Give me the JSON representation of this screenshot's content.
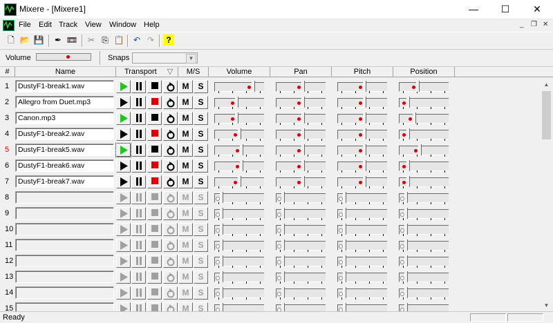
{
  "window": {
    "title": "Mixere - [Mixere1]",
    "minimize": "—",
    "maximize": "☐",
    "close": "✕"
  },
  "menubar": {
    "items": [
      "File",
      "Edit",
      "Track",
      "View",
      "Window",
      "Help"
    ],
    "mdi": {
      "minimize": "_",
      "restore": "❐",
      "close": "✕"
    }
  },
  "toolbar": {
    "icons": [
      "new-icon",
      "open-icon",
      "save-icon",
      "properties-icon",
      "tape-icon",
      "cut-icon",
      "copy-icon",
      "paste-icon",
      "undo-icon",
      "redo-icon",
      "help-icon"
    ],
    "glyphs": [
      "🗋",
      "📂",
      "💾",
      "✒",
      "📼",
      "✂",
      "⎘",
      "📋",
      "↶",
      "↷",
      "?"
    ]
  },
  "mixbar": {
    "volume_label": "Volume",
    "snaps_label": "Snaps",
    "snaps_value": "",
    "volume_level": 0.75
  },
  "header": {
    "num": "#",
    "name": "Name",
    "transport": "Transport",
    "transport_arrow": "▽",
    "ms": "M/S",
    "volume": "Volume",
    "pan": "Pan",
    "pitch": "Pitch",
    "position": "Position"
  },
  "labels": {
    "mute": "M",
    "solo": "S"
  },
  "rows": [
    {
      "num": "1",
      "name": "DustyF1-break1.wav",
      "active": true,
      "playing": true,
      "recording": false,
      "vol": 0.8,
      "pan": 0.5,
      "pitch": 0.5,
      "pos": 0.3
    },
    {
      "num": "2",
      "name": "Allegro from Duet.mp3",
      "active": true,
      "playing": false,
      "recording": true,
      "vol": 0.38,
      "pan": 0.5,
      "pitch": 0.5,
      "pos": 0.05
    },
    {
      "num": "3",
      "name": "Canon.mp3",
      "active": true,
      "playing": true,
      "recording": false,
      "vol": 0.38,
      "pan": 0.5,
      "pitch": 0.5,
      "pos": 0.2
    },
    {
      "num": "4",
      "name": "DustyF1-break2.wav",
      "active": true,
      "playing": false,
      "recording": true,
      "vol": 0.45,
      "pan": 0.5,
      "pitch": 0.5,
      "pos": 0.05
    },
    {
      "num": "5",
      "name": "DustyF1-break5.wav",
      "active": true,
      "playing": true,
      "recording": false,
      "vol": 0.5,
      "pan": 0.5,
      "pitch": 0.5,
      "pos": 0.35,
      "highlight": true
    },
    {
      "num": "6",
      "name": "DustyF1-break6.wav",
      "active": true,
      "playing": false,
      "recording": true,
      "vol": 0.5,
      "pan": 0.5,
      "pitch": 0.5,
      "pos": 0.05
    },
    {
      "num": "7",
      "name": "DustyF1-break7.wav",
      "active": true,
      "playing": false,
      "recording": true,
      "vol": 0.45,
      "pan": 0.5,
      "pitch": 0.5,
      "pos": 0.05
    },
    {
      "num": "8",
      "name": "",
      "active": false
    },
    {
      "num": "9",
      "name": "",
      "active": false
    },
    {
      "num": "10",
      "name": "",
      "active": false
    },
    {
      "num": "11",
      "name": "",
      "active": false
    },
    {
      "num": "12",
      "name": "",
      "active": false
    },
    {
      "num": "13",
      "name": "",
      "active": false
    },
    {
      "num": "14",
      "name": "",
      "active": false
    },
    {
      "num": "15",
      "name": "",
      "active": false
    }
  ],
  "status": {
    "text": "Ready"
  },
  "colors": {
    "play_active": "#22c322",
    "record": "#e00000",
    "disabled": "#a0a0a0"
  }
}
